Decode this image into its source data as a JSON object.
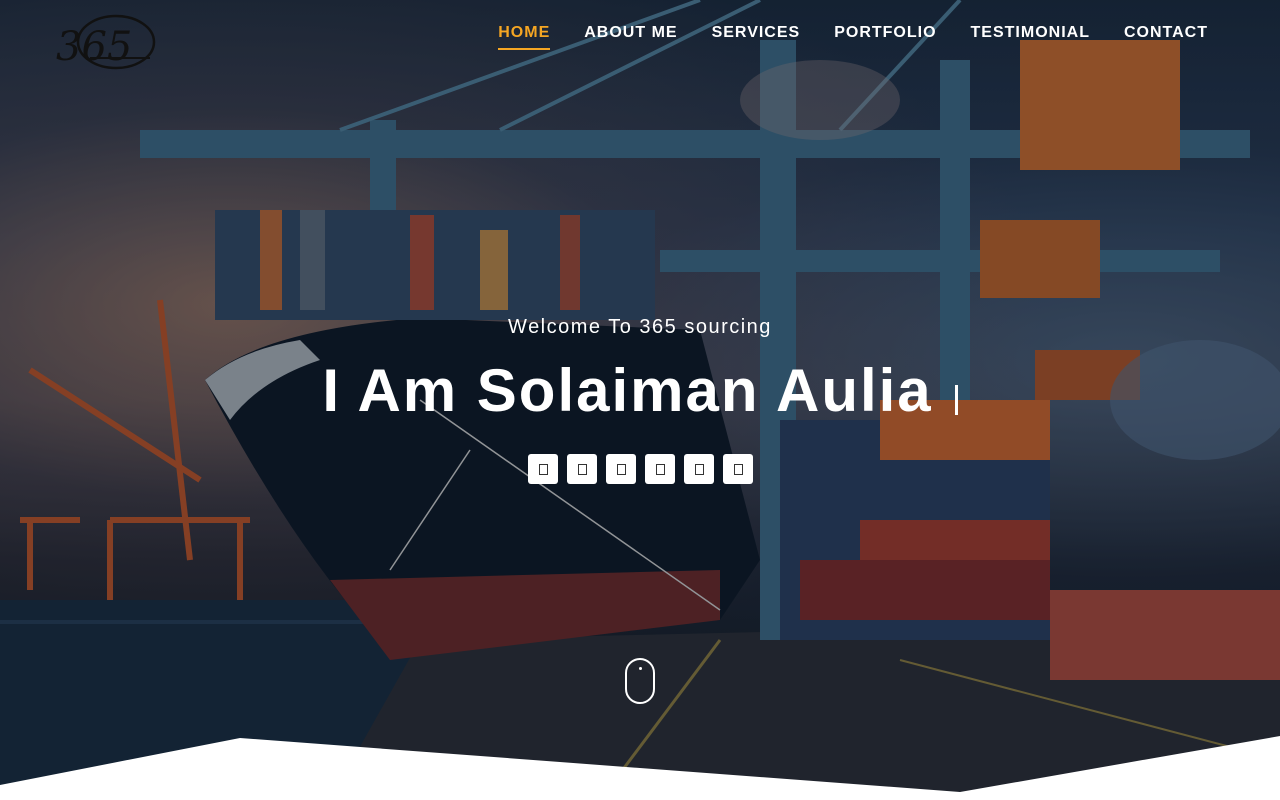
{
  "brand": {
    "logo_text": "365"
  },
  "nav": {
    "items": [
      {
        "label": "HOME",
        "active": true
      },
      {
        "label": "ABOUT ME",
        "active": false
      },
      {
        "label": "SERVICES",
        "active": false
      },
      {
        "label": "PORTFOLIO",
        "active": false
      },
      {
        "label": "TESTIMONIAL",
        "active": false
      },
      {
        "label": "CONTACT",
        "active": false
      }
    ],
    "active_color": "#f5a623"
  },
  "hero": {
    "welcome": "Welcome To 365 sourcing",
    "headline": "I Am Solaiman Aulia",
    "social_icons": [
      "social-icon-1",
      "social-icon-2",
      "social-icon-3",
      "social-icon-4",
      "social-icon-5",
      "social-icon-6"
    ]
  },
  "scroll_indicator": {
    "icon": "mouse-scroll-icon"
  }
}
